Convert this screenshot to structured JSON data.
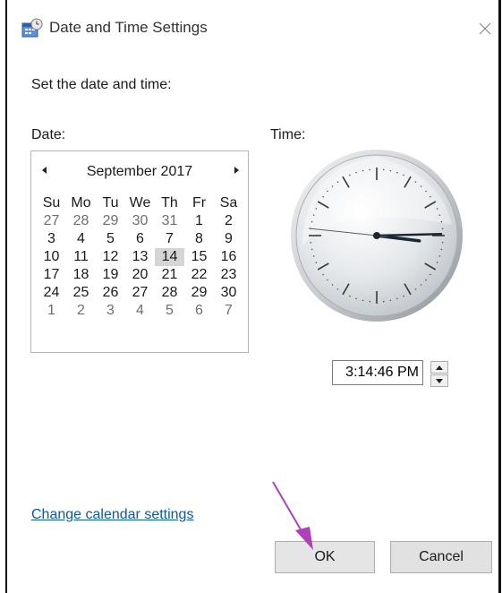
{
  "window": {
    "title": "Date and Time Settings",
    "icon": "date-time-settings-icon",
    "close_icon": "close-icon"
  },
  "heading": "Set the date and time:",
  "date_label": "Date:",
  "time_label": "Time:",
  "calendar": {
    "month_label": "September 2017",
    "prev_icon": "triangle-left-icon",
    "next_icon": "triangle-right-icon",
    "weekdays": [
      "Su",
      "Mo",
      "Tu",
      "We",
      "Th",
      "Fr",
      "Sa"
    ],
    "selected_day": "14",
    "weeks": [
      [
        "27",
        "28",
        "29",
        "30",
        "31",
        "1",
        "2"
      ],
      [
        "3",
        "4",
        "5",
        "6",
        "7",
        "8",
        "9"
      ],
      [
        "10",
        "11",
        "12",
        "13",
        "14",
        "15",
        "16"
      ],
      [
        "17",
        "18",
        "19",
        "20",
        "21",
        "22",
        "23"
      ],
      [
        "24",
        "25",
        "26",
        "27",
        "28",
        "29",
        "30"
      ],
      [
        "1",
        "2",
        "3",
        "4",
        "5",
        "6",
        "7"
      ]
    ],
    "other_month_mask": [
      [
        true,
        true,
        true,
        true,
        true,
        false,
        false
      ],
      [
        false,
        false,
        false,
        false,
        false,
        false,
        false
      ],
      [
        false,
        false,
        false,
        false,
        false,
        false,
        false
      ],
      [
        false,
        false,
        false,
        false,
        false,
        false,
        false
      ],
      [
        false,
        false,
        false,
        false,
        false,
        false,
        false
      ],
      [
        true,
        true,
        true,
        true,
        true,
        true,
        true
      ]
    ]
  },
  "clock": {
    "hour": 3,
    "minute": 14,
    "second": 46
  },
  "time_field": {
    "value": "3:14:46 PM",
    "up_icon": "spin-up-icon",
    "down_icon": "spin-down-icon"
  },
  "links": {
    "change_calendar": "Change calendar settings"
  },
  "buttons": {
    "ok": "OK",
    "cancel": "Cancel"
  },
  "colors": {
    "link": "#0a5aa6",
    "selected_day_bg": "#d5d5d5",
    "annotation_arrow": "#b040b8"
  }
}
